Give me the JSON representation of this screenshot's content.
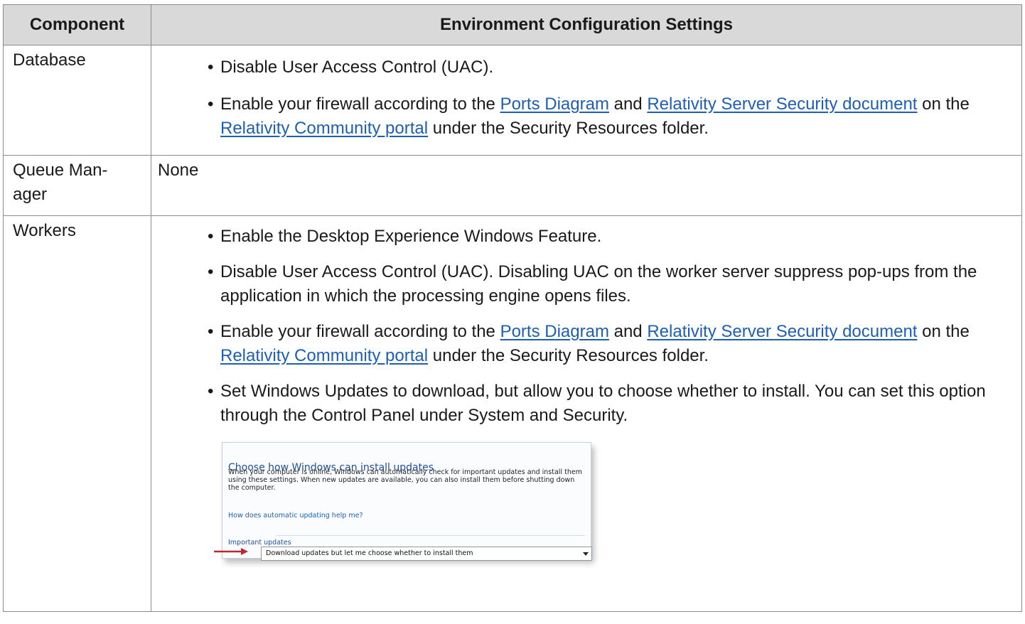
{
  "table": {
    "headers": [
      "Component",
      "Environment Configuration Settings"
    ],
    "rows": [
      {
        "component": "Database",
        "items": [
          {
            "bullet": "•",
            "text": "Disable User Access Control (UAC)."
          },
          {
            "bullet": "•",
            "p1": "Enable your firewall according to the ",
            "link1": "Ports Diagram",
            "p2": " and ",
            "link2": "Relativity Server Security document",
            "p3": " on the ",
            "link3": "Relativity Community portal",
            "p4": " under the Security Resources folder."
          }
        ]
      },
      {
        "component": "Queue Man-\nager",
        "component_line1": "Queue Man-",
        "component_line2": "ager",
        "value": "None"
      },
      {
        "component": "Workers",
        "items": [
          {
            "bullet": "•",
            "text": " Enable the Desktop Experience Windows Feature."
          },
          {
            "bullet": "•",
            "text": "Disable User Access Control (UAC). Disabling UAC on the worker server suppress pop-ups from the application in which the processing engine opens files."
          },
          {
            "bullet": "•",
            "p1": "Enable your firewall according to the ",
            "link1": "Ports Diagram",
            "p2": " and ",
            "link2": "Relativity Server Security document",
            "p3": " on the ",
            "link3": "Relativity Community portal",
            "p4": " under the Security Resources folder."
          },
          {
            "bullet": "•",
            "text": "Set Windows Updates to download, but allow you to choose whether to install. You can set this option through the Control Panel under System and Security."
          }
        ],
        "screenshot": {
          "title": "Choose how Windows can install updates",
          "description": "When your computer is online, Windows can automatically check for important updates and install them using these settings. When new updates are available, you can also install them before shutting down the computer.",
          "help_link": "How does automatic updating help me?",
          "section": "Important updates",
          "selected_option": "Download updates but let me choose whether to install them"
        }
      }
    ]
  },
  "colors": {
    "header_bg": "#d9d9d9",
    "link": "#1e5fb4",
    "border": "#8a8a8a",
    "arrow": "#c0262d"
  }
}
